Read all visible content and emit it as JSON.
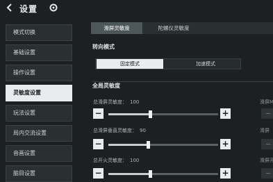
{
  "header": {
    "title": "设置"
  },
  "sidebar": {
    "items": [
      {
        "label": "模式切换"
      },
      {
        "label": "基础设置"
      },
      {
        "label": "操作设置"
      },
      {
        "label": "灵敏度设置"
      },
      {
        "label": "玩法设置"
      },
      {
        "label": "局内交流设置"
      },
      {
        "label": "音画设置"
      },
      {
        "label": "脑目设置"
      }
    ]
  },
  "tabs": [
    {
      "label": "滑屏灵敏度"
    },
    {
      "label": "陀螺仪灵敏度"
    }
  ],
  "turn_mode": {
    "title": "转向模式",
    "options": [
      {
        "label": "固定模式"
      },
      {
        "label": "加速模式"
      }
    ]
  },
  "global_sensitivity": {
    "title": "全局灵敏度",
    "sliders": [
      {
        "label": "总滑屏灵敏度：",
        "value": "100",
        "fraction": 0.38
      },
      {
        "label": "总滑屏垂直灵敏度：",
        "value": "90",
        "fraction": 0.36
      },
      {
        "label": "总开火灵敏度：",
        "value": "100",
        "fraction": 0.38
      }
    ]
  },
  "right_edge": {
    "labels": [
      "滑屏M",
      "滑屏",
      "滑屏开"
    ]
  }
}
